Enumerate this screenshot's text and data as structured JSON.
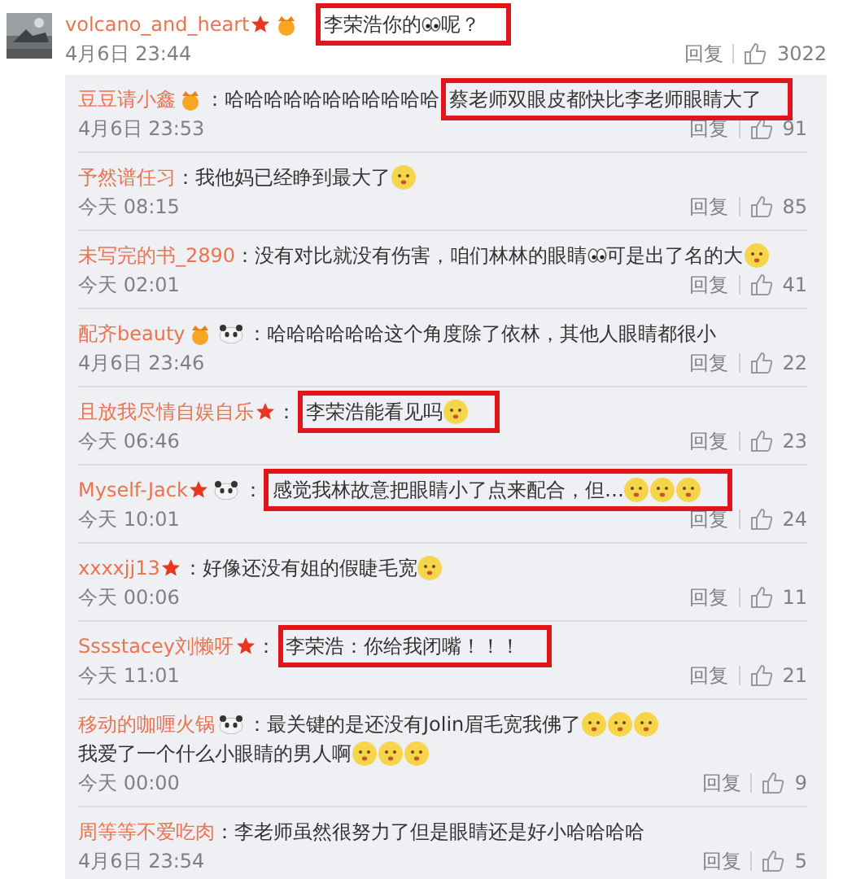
{
  "comment": {
    "name": "volcano_and_heart",
    "badges": [
      {
        "kind": "star"
      },
      {
        "kind": "vip"
      }
    ],
    "highlight": [
      {
        "kind": "text",
        "text": "李荣浩你的"
      },
      {
        "kind": "eyes"
      },
      {
        "kind": "text",
        "text": "呢？"
      }
    ],
    "time": "4月6日 23:44",
    "reply": "回复",
    "likes": "3022"
  },
  "replies": [
    {
      "name": "豆豆请小鑫",
      "badges": [
        {
          "kind": "vip"
        }
      ],
      "content": [
        {
          "kind": "text",
          "text": "：哈哈哈哈哈哈哈哈哈哈哈"
        }
      ],
      "highlight": [
        {
          "kind": "text",
          "text": "蔡老师双眼皮都快比李老师眼睛大了"
        }
      ],
      "time": "4月6日 23:53",
      "reply": "回复",
      "likes": "91"
    },
    {
      "name": "予然谱任习",
      "content": [
        {
          "kind": "text",
          "text": "：我他妈已经睁到最大了"
        },
        {
          "kind": "face"
        }
      ],
      "time": "今天 08:15",
      "reply": "回复",
      "likes": "85"
    },
    {
      "name": "未写完的书_2890",
      "content": [
        {
          "kind": "text",
          "text": "：没有对比就没有伤害，咱们林林的眼睛"
        },
        {
          "kind": "eyes"
        },
        {
          "kind": "text",
          "text": "可是出了名的大"
        },
        {
          "kind": "face"
        }
      ],
      "time": "今天 02:01",
      "reply": "回复",
      "likes": "41"
    },
    {
      "name": "配齐beauty",
      "badges": [
        {
          "kind": "vip"
        },
        {
          "kind": "panda"
        }
      ],
      "content": [
        {
          "kind": "text",
          "text": "：哈哈哈哈哈哈这个角度除了依林，其他人眼睛都很小"
        }
      ],
      "time": "4月6日 23:46",
      "reply": "回复",
      "likes": "22"
    },
    {
      "name": "且放我尽情自娱自乐",
      "badges": [
        {
          "kind": "star"
        }
      ],
      "content": [
        {
          "kind": "text",
          "text": "："
        }
      ],
      "highlight": [
        {
          "kind": "text",
          "text": "李荣浩能看见吗"
        },
        {
          "kind": "face"
        }
      ],
      "time": "今天 06:46",
      "reply": "回复",
      "likes": "23"
    },
    {
      "name": "Myself-Jack",
      "badges": [
        {
          "kind": "star"
        },
        {
          "kind": "panda"
        }
      ],
      "content": [
        {
          "kind": "text",
          "text": "："
        }
      ],
      "highlight": [
        {
          "kind": "text",
          "text": "感觉我林故意把眼睛小了点来配合，但…"
        },
        {
          "kind": "face"
        },
        {
          "kind": "face"
        },
        {
          "kind": "face"
        }
      ],
      "time": "今天 10:01",
      "reply": "回复",
      "likes": "24"
    },
    {
      "name": "xxxxjj13",
      "badges": [
        {
          "kind": "star"
        }
      ],
      "content": [
        {
          "kind": "text",
          "text": "：好像还没有姐的假睫毛宽"
        },
        {
          "kind": "face"
        }
      ],
      "time": "今天 00:06",
      "reply": "回复",
      "likes": "11"
    },
    {
      "name": "Sssstacey刘懒呀",
      "badges": [
        {
          "kind": "star"
        }
      ],
      "content": [
        {
          "kind": "text",
          "text": "："
        }
      ],
      "highlight": [
        {
          "kind": "text",
          "text": "李荣浩：你给我闭嘴！！！"
        }
      ],
      "time": "今天 11:01",
      "reply": "回复",
      "likes": "21"
    },
    {
      "name": "移动的咖喱火锅",
      "badges": [
        {
          "kind": "panda"
        }
      ],
      "content": [
        {
          "kind": "text",
          "text": "：最关键的是还没有Jolin眉毛宽我佛了"
        },
        {
          "kind": "face"
        },
        {
          "kind": "face"
        },
        {
          "kind": "face"
        },
        {
          "kind": "text",
          "text": "我爱了一个什么小眼睛的男人啊"
        },
        {
          "kind": "face"
        },
        {
          "kind": "face"
        },
        {
          "kind": "face"
        }
      ],
      "time": "今天 00:00",
      "reply": "回复",
      "likes": "9"
    },
    {
      "name": "周等等不爱吃肉",
      "content": [
        {
          "kind": "text",
          "text": "：李老师虽然很努力了但是眼睛还是好小哈哈哈哈"
        }
      ],
      "time": "4月6日 23:54",
      "reply": "回复",
      "likes": "5"
    }
  ]
}
